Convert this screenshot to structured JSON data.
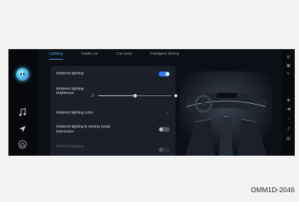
{
  "sidebar": {
    "assistant_label": "",
    "icons": [
      "assistant-icon",
      "music-icon",
      "navigation-icon",
      "home-icon"
    ]
  },
  "tabs": [
    {
      "label": "Lighting",
      "active": true
    },
    {
      "label": "Inside car",
      "active": false
    },
    {
      "label": "Car body",
      "active": false
    },
    {
      "label": "Intelligent driving",
      "active": false
    }
  ],
  "settings": {
    "ambient_lighting": {
      "label": "Ambient lighting",
      "on": true
    },
    "brightness": {
      "label": "Ambient lighting brightness",
      "level": 0.5
    },
    "color": {
      "label": "Ambient lighting color"
    },
    "driving_interaction": {
      "label": "Ambient lighting & driving mode interaction",
      "on": false
    },
    "partial": {
      "label": "Ambient lighting",
      "on": false
    }
  },
  "caption": "OMM1D-2046",
  "colors": {
    "accent": "#4aa3ff",
    "toggle_on": "#2d7cf0",
    "panel": "#1a1f28"
  }
}
